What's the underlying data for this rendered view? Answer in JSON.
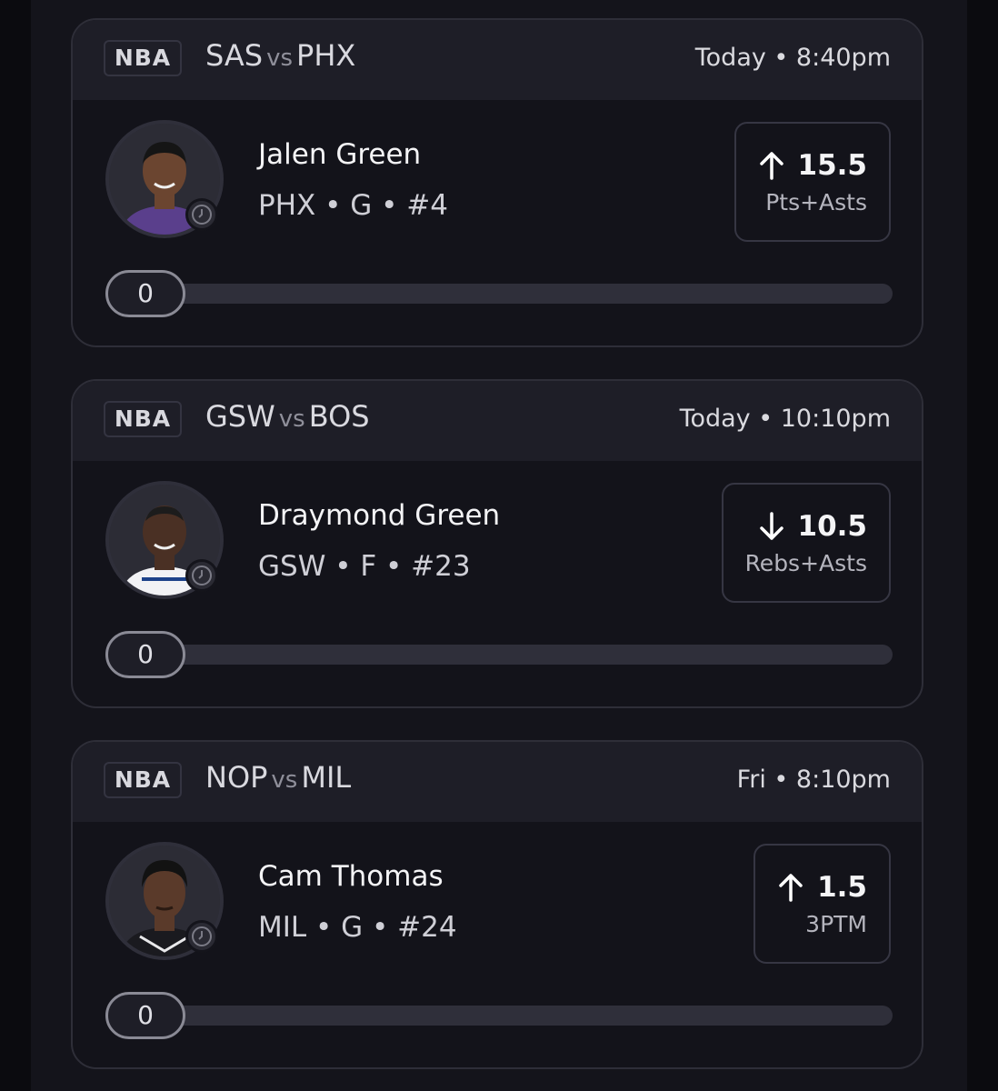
{
  "picks": [
    {
      "league": "NBA",
      "team_a": "SAS",
      "vs": "vs",
      "team_b": "PHX",
      "time": "Today • 8:40pm",
      "player": {
        "name": "Jalen Green",
        "info": "PHX • G • #4",
        "jersey_color": "#5a3f8c",
        "skin_color": "#6b4530"
      },
      "projection": {
        "direction": "up",
        "value": "15.5",
        "stat": "Pts+Asts"
      },
      "progress": {
        "count": "0",
        "fraction": 0
      }
    },
    {
      "league": "NBA",
      "team_a": "GSW",
      "vs": "vs",
      "team_b": "BOS",
      "time": "Today • 10:10pm",
      "player": {
        "name": "Draymond Green",
        "info": "GSW • F • #23",
        "jersey_color": "#f2f2f5",
        "skin_color": "#4a3024"
      },
      "projection": {
        "direction": "down",
        "value": "10.5",
        "stat": "Rebs+Asts"
      },
      "progress": {
        "count": "0",
        "fraction": 0
      }
    },
    {
      "league": "NBA",
      "team_a": "NOP",
      "vs": "vs",
      "team_b": "MIL",
      "time": "Fri • 8:10pm",
      "player": {
        "name": "Cam Thomas",
        "info": "MIL • G • #24",
        "jersey_color": "#1a1a1f",
        "skin_color": "#5a3a2a"
      },
      "projection": {
        "direction": "up",
        "value": "1.5",
        "stat": "3PTM"
      },
      "progress": {
        "count": "0",
        "fraction": 0
      }
    }
  ]
}
